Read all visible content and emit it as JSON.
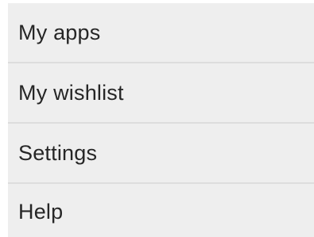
{
  "menu": {
    "items": [
      {
        "label": "My apps"
      },
      {
        "label": "My wishlist"
      },
      {
        "label": "Settings"
      },
      {
        "label": "Help"
      }
    ]
  }
}
